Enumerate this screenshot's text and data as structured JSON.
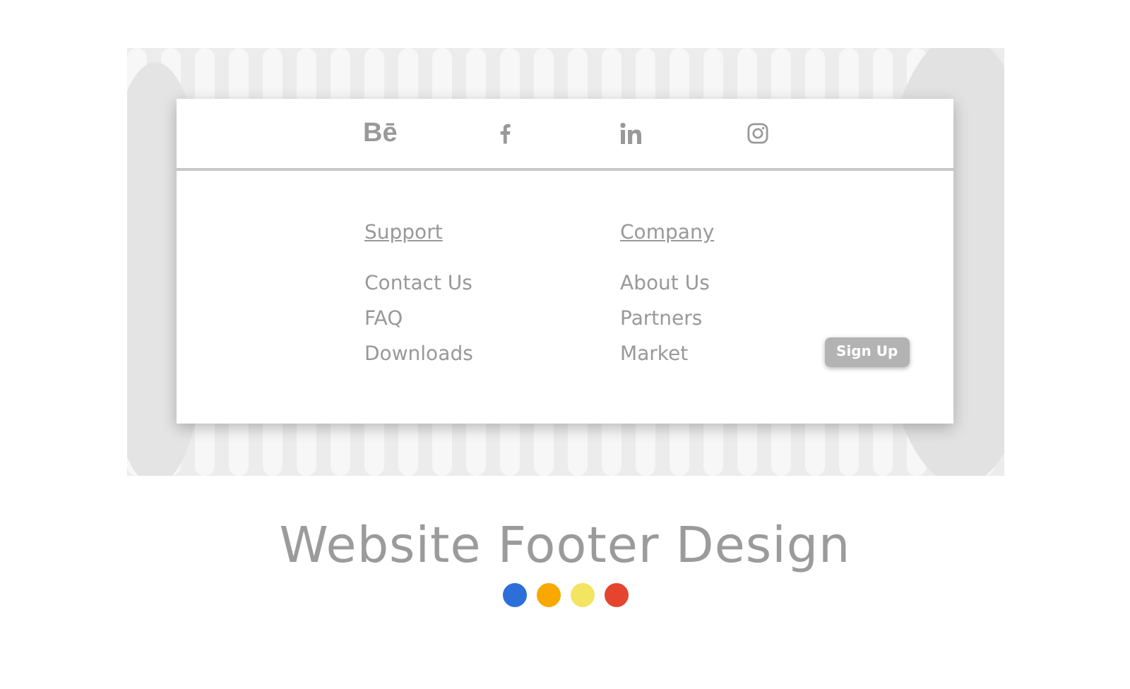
{
  "social": [
    {
      "kind": "behance",
      "text": "Bē"
    },
    {
      "kind": "facebook"
    },
    {
      "kind": "linkedin"
    },
    {
      "kind": "instagram"
    }
  ],
  "columns": [
    {
      "heading": "Support",
      "links": [
        "Contact Us",
        "FAQ",
        "Downloads"
      ]
    },
    {
      "heading": "Company",
      "links": [
        "About Us",
        "Partners",
        "Market"
      ]
    }
  ],
  "signup_button": "Sign Up",
  "caption": "Website Footer Design",
  "palette": [
    {
      "color": "#2d6fd9"
    },
    {
      "color": "#f9a800"
    },
    {
      "color": "#f3e462"
    },
    {
      "color": "#e5452f"
    }
  ]
}
